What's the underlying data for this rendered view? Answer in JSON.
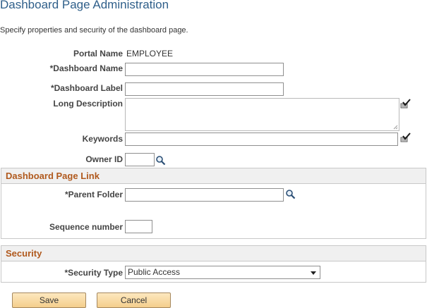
{
  "page": {
    "title": "Dashboard Page Administration",
    "instructions": "Specify properties and security of the dashboard page."
  },
  "form": {
    "portal_name_label": "Portal Name",
    "portal_name_value": "EMPLOYEE",
    "dashboard_name_label": "*Dashboard Name",
    "dashboard_name_value": "",
    "dashboard_label_label": "*Dashboard Label",
    "dashboard_label_value": "",
    "long_description_label": "Long Description",
    "long_description_value": "",
    "keywords_label": "Keywords",
    "keywords_value": "",
    "owner_id_label": "Owner ID",
    "owner_id_value": ""
  },
  "link_section": {
    "title": "Dashboard Page Link",
    "parent_folder_label": "*Parent Folder",
    "parent_folder_value": "",
    "sequence_label": "Sequence number",
    "sequence_value": ""
  },
  "security_section": {
    "title": "Security",
    "security_type_label": "*Security Type",
    "security_type_value": "Public Access"
  },
  "actions": {
    "save_label": "Save",
    "cancel_label": "Cancel"
  },
  "icons": {
    "spellcheck": "spellcheck-icon",
    "lookup": "lookup-magnifier-icon",
    "dropdown": "chevron-down-icon"
  }
}
